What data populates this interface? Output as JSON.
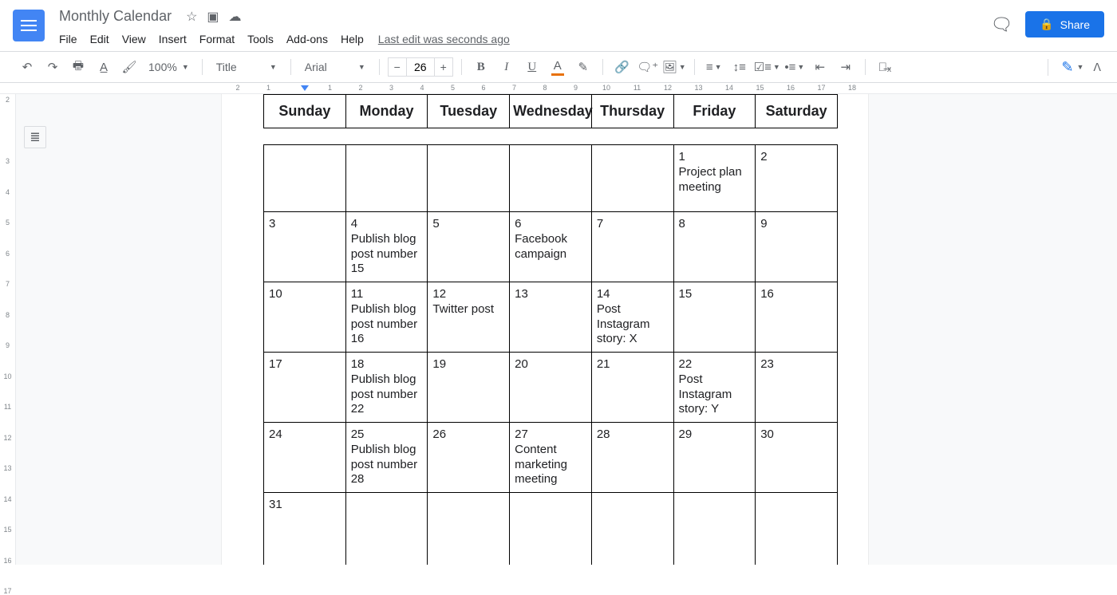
{
  "header": {
    "doc_title": "Monthly Calendar",
    "menu": [
      "File",
      "Edit",
      "View",
      "Insert",
      "Format",
      "Tools",
      "Add-ons",
      "Help"
    ],
    "last_edit": "Last edit was seconds ago",
    "share_label": "Share"
  },
  "toolbar": {
    "zoom": "100%",
    "style": "Title",
    "font": "Arial",
    "font_size": "26"
  },
  "ruler_h": [
    "2",
    "1",
    "",
    "1",
    "2",
    "3",
    "4",
    "5",
    "6",
    "7",
    "8",
    "9",
    "10",
    "11",
    "12",
    "13",
    "14",
    "15",
    "16",
    "17",
    "18"
  ],
  "ruler_v": [
    "2",
    "",
    "3",
    "4",
    "5",
    "6",
    "7",
    "8",
    "9",
    "10",
    "11",
    "12",
    "13",
    "14",
    "15",
    "16",
    "17"
  ],
  "calendar": {
    "day_headers": [
      "Sunday",
      "Monday",
      "Tuesday",
      "Wednesday",
      "Thursday",
      "Friday",
      "Saturday"
    ],
    "weeks": [
      [
        {
          "day": "",
          "event": ""
        },
        {
          "day": "",
          "event": ""
        },
        {
          "day": "",
          "event": ""
        },
        {
          "day": "",
          "event": ""
        },
        {
          "day": "",
          "event": ""
        },
        {
          "day": "1",
          "event": "Project plan meeting"
        },
        {
          "day": "2",
          "event": ""
        }
      ],
      [
        {
          "day": "3",
          "event": ""
        },
        {
          "day": "4",
          "event": "Publish blog post number 15"
        },
        {
          "day": "5",
          "event": ""
        },
        {
          "day": "6",
          "event": "Facebook campaign"
        },
        {
          "day": "7",
          "event": ""
        },
        {
          "day": "8",
          "event": ""
        },
        {
          "day": "9",
          "event": ""
        }
      ],
      [
        {
          "day": "10",
          "event": ""
        },
        {
          "day": "11",
          "event": "Publish blog post number 16"
        },
        {
          "day": "12",
          "event": "Twitter post"
        },
        {
          "day": "13",
          "event": ""
        },
        {
          "day": "14",
          "event": "Post Instagram story: X"
        },
        {
          "day": "15",
          "event": ""
        },
        {
          "day": "16",
          "event": ""
        }
      ],
      [
        {
          "day": "17",
          "event": ""
        },
        {
          "day": "18",
          "event": "Publish blog post number 22"
        },
        {
          "day": "19",
          "event": ""
        },
        {
          "day": "20",
          "event": ""
        },
        {
          "day": "21",
          "event": ""
        },
        {
          "day": "22",
          "event": "Post Instagram story: Y"
        },
        {
          "day": "23",
          "event": ""
        }
      ],
      [
        {
          "day": "24",
          "event": ""
        },
        {
          "day": "25",
          "event": "Publish blog post number 28"
        },
        {
          "day": "26",
          "event": ""
        },
        {
          "day": "27",
          "event": "Content marketing meeting"
        },
        {
          "day": "28",
          "event": ""
        },
        {
          "day": "29",
          "event": ""
        },
        {
          "day": "30",
          "event": ""
        }
      ],
      [
        {
          "day": "31",
          "event": ""
        },
        {
          "day": "",
          "event": ""
        },
        {
          "day": "",
          "event": ""
        },
        {
          "day": "",
          "event": ""
        },
        {
          "day": "",
          "event": ""
        },
        {
          "day": "",
          "event": ""
        },
        {
          "day": "",
          "event": ""
        }
      ]
    ]
  }
}
